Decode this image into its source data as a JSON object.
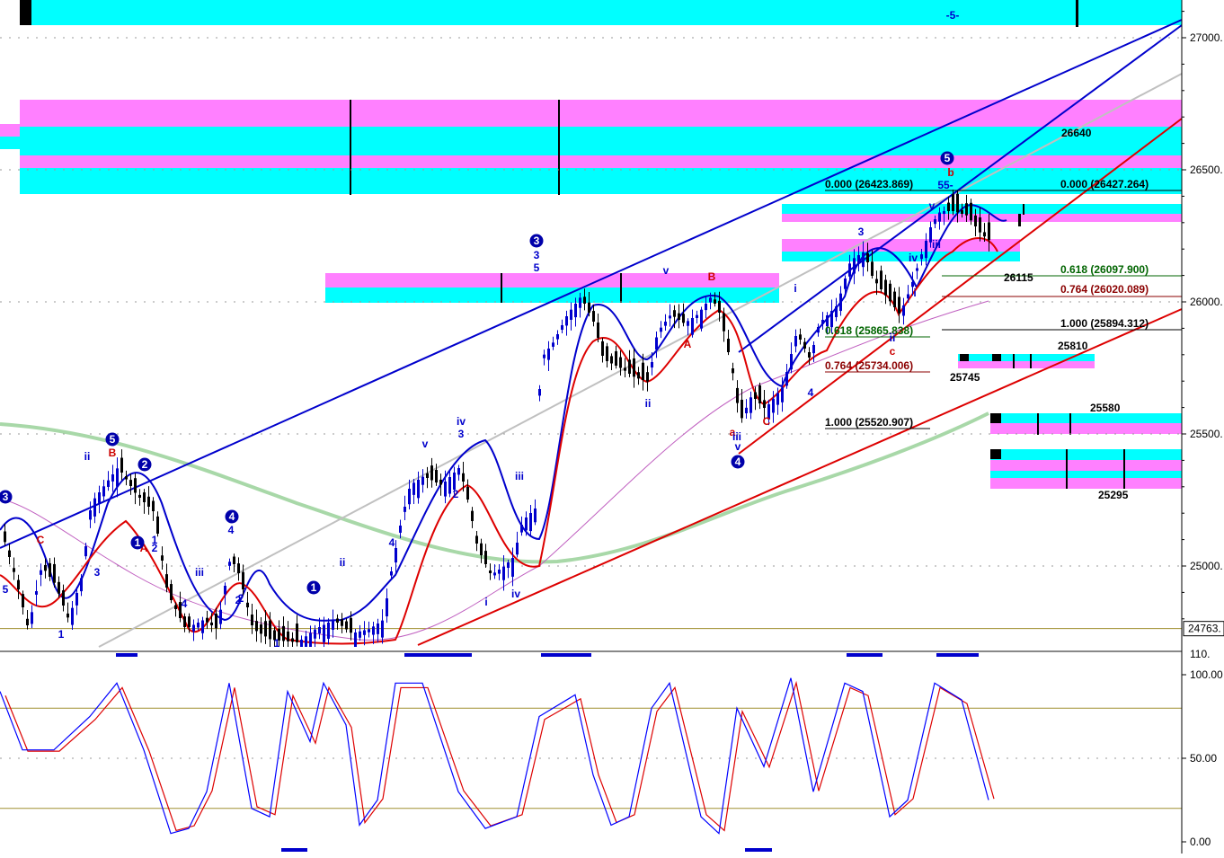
{
  "chart_data": {
    "type": "candlestick",
    "price_axis": {
      "ticks": [
        {
          "label": "27000.",
          "value": 27000
        },
        {
          "label": "26500.",
          "value": 26500
        },
        {
          "label": "26000.",
          "value": 26000
        },
        {
          "label": "25500.",
          "value": 25500
        },
        {
          "label": "25000.",
          "value": 25000
        }
      ],
      "current_price_label": "24763.",
      "current_price": 24763,
      "range": [
        24700,
        27150
      ]
    },
    "oscillator_axis": {
      "ticks": [
        {
          "label": "100.00",
          "value": 100
        },
        {
          "label": "50.00",
          "value": 50
        },
        {
          "label": "0.00",
          "value": 0
        }
      ],
      "top_label": "110.",
      "overbought": 80,
      "oversold": 20,
      "range": [
        -8,
        110
      ]
    },
    "top_bar_label": "-5-",
    "fibonacci_levels": [
      {
        "label": "0.000  (26423.869)",
        "price": 26423.869,
        "color": "#000000"
      },
      {
        "label": "0.000  (26427.264)",
        "price": 26427.264,
        "color": "#000000"
      },
      {
        "label": "0.618  (26097.900)",
        "price": 26097.9,
        "color": "#006400"
      },
      {
        "label": "0.764  (26020.089)",
        "price": 26020.089,
        "color": "#8b0000"
      },
      {
        "label": "1.000  (25894.312)",
        "price": 25894.312,
        "color": "#000000"
      },
      {
        "label": "0.618  (25865.838)",
        "price": 25865.838,
        "color": "#006400"
      },
      {
        "label": "0.764  (25734.006)",
        "price": 25734.006,
        "color": "#8b0000"
      },
      {
        "label": "1.000  (25520.907)",
        "price": 25520.907,
        "color": "#000000"
      }
    ],
    "price_zone_labels": [
      "26640",
      "26115",
      "25810",
      "25745",
      "25580",
      "25295"
    ],
    "wave_labels": [
      {
        "text": "3",
        "color": "#0000cc"
      },
      {
        "text": "5",
        "color": "#0000cc"
      },
      {
        "text": "v",
        "color": "#0000cc"
      },
      {
        "text": "B",
        "color": "#cc0000"
      },
      {
        "text": "ii",
        "color": "#0000cc"
      },
      {
        "text": "A",
        "color": "#cc0000"
      },
      {
        "text": "i",
        "color": "#0000cc"
      },
      {
        "text": "3",
        "color": "#0000cc"
      },
      {
        "text": "b",
        "color": "#cc0000"
      },
      {
        "text": "55-",
        "color": "#0000cc"
      },
      {
        "text": "v",
        "color": "#0000cc"
      },
      {
        "text": "iii",
        "color": "#0000cc"
      },
      {
        "text": "iv",
        "color": "#0000cc"
      },
      {
        "text": "i",
        "color": "#0000cc"
      },
      {
        "text": "ii",
        "color": "#0000cc"
      },
      {
        "text": "c",
        "color": "#cc0000"
      },
      {
        "text": "4",
        "color": "#0000cc"
      },
      {
        "text": "a",
        "color": "#cc0000"
      },
      {
        "text": "iii",
        "color": "#0000cc"
      },
      {
        "text": "v",
        "color": "#0000cc"
      },
      {
        "text": "C",
        "color": "#cc0000"
      },
      {
        "text": "2",
        "color": "#0000cc"
      },
      {
        "text": "iv",
        "color": "#0000cc"
      },
      {
        "text": "3",
        "color": "#0000cc"
      },
      {
        "text": "v",
        "color": "#0000cc"
      },
      {
        "text": "iii",
        "color": "#0000cc"
      },
      {
        "text": "iv",
        "color": "#0000cc"
      },
      {
        "text": "i",
        "color": "#0000cc"
      },
      {
        "text": "ii",
        "color": "#0000cc"
      },
      {
        "text": "4",
        "color": "#0000cc"
      },
      {
        "text": "iii",
        "color": "#0000cc"
      },
      {
        "text": "ii",
        "color": "#0000cc"
      },
      {
        "text": "B",
        "color": "#cc0000"
      },
      {
        "text": "C",
        "color": "#cc0000"
      },
      {
        "text": "A",
        "color": "#cc0000"
      },
      {
        "text": "3",
        "color": "#0000cc"
      },
      {
        "text": "5",
        "color": "#0000cc"
      },
      {
        "text": "1",
        "color": "#0000cc"
      },
      {
        "text": "2",
        "color": "#0000cc"
      },
      {
        "text": "4",
        "color": "#0000cc"
      },
      {
        "text": "1",
        "color": "#0000cc"
      },
      {
        "text": "2",
        "color": "#0000cc"
      },
      {
        "text": "2",
        "color": "#0000cc"
      },
      {
        "text": "4",
        "color": "#0000cc"
      },
      {
        "text": "1",
        "color": "#0000cc"
      }
    ],
    "circled_wave_labels": [
      {
        "text": "3"
      },
      {
        "text": "5"
      },
      {
        "text": "2"
      },
      {
        "text": "1"
      },
      {
        "text": "4"
      },
      {
        "text": "1"
      },
      {
        "text": "3"
      },
      {
        "text": "4"
      },
      {
        "text": "5"
      }
    ],
    "colors": {
      "up_candle": "#0000cc",
      "down_candle": "#000000",
      "zone_cyan": "#00ffff",
      "zone_magenta": "#ff80ff",
      "trendline_blue": "#0000cc",
      "trendline_red": "#dd0000",
      "ma_green": "#a8d8a8",
      "ma_gray": "#c0c0c0",
      "ma_purple": "#c060c0",
      "osc_fast": "#0000ff",
      "osc_slow": "#dd0000",
      "guide_olive": "#a09030"
    }
  }
}
